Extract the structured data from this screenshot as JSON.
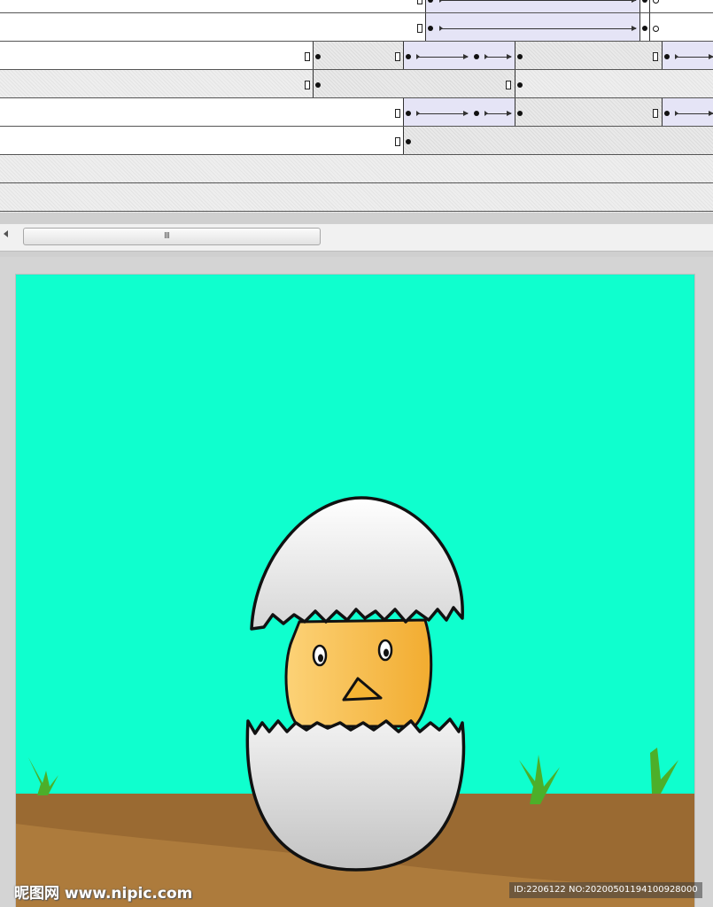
{
  "timeline": {
    "layer_count": 8,
    "visible_span_colors": {
      "static": "#e6e6e6",
      "tween": "#e5e4f6",
      "empty": "#ffffff"
    }
  },
  "scrollbar": {
    "grip_glyph": "III",
    "left_arrow_icon": "triangle-left-icon"
  },
  "stage": {
    "sky_color": "#0fffce",
    "ground_color": "#9a6a32",
    "ground_light_color": "#ad7b3c",
    "grass_color": "#4caf2a",
    "chick_color": "#f6b843",
    "egg_shell_color": "#ececec"
  },
  "watermark": {
    "site": "昵图网 www.nipic.com",
    "id_text": "ID:2206122 NO:20200501194100928000"
  }
}
